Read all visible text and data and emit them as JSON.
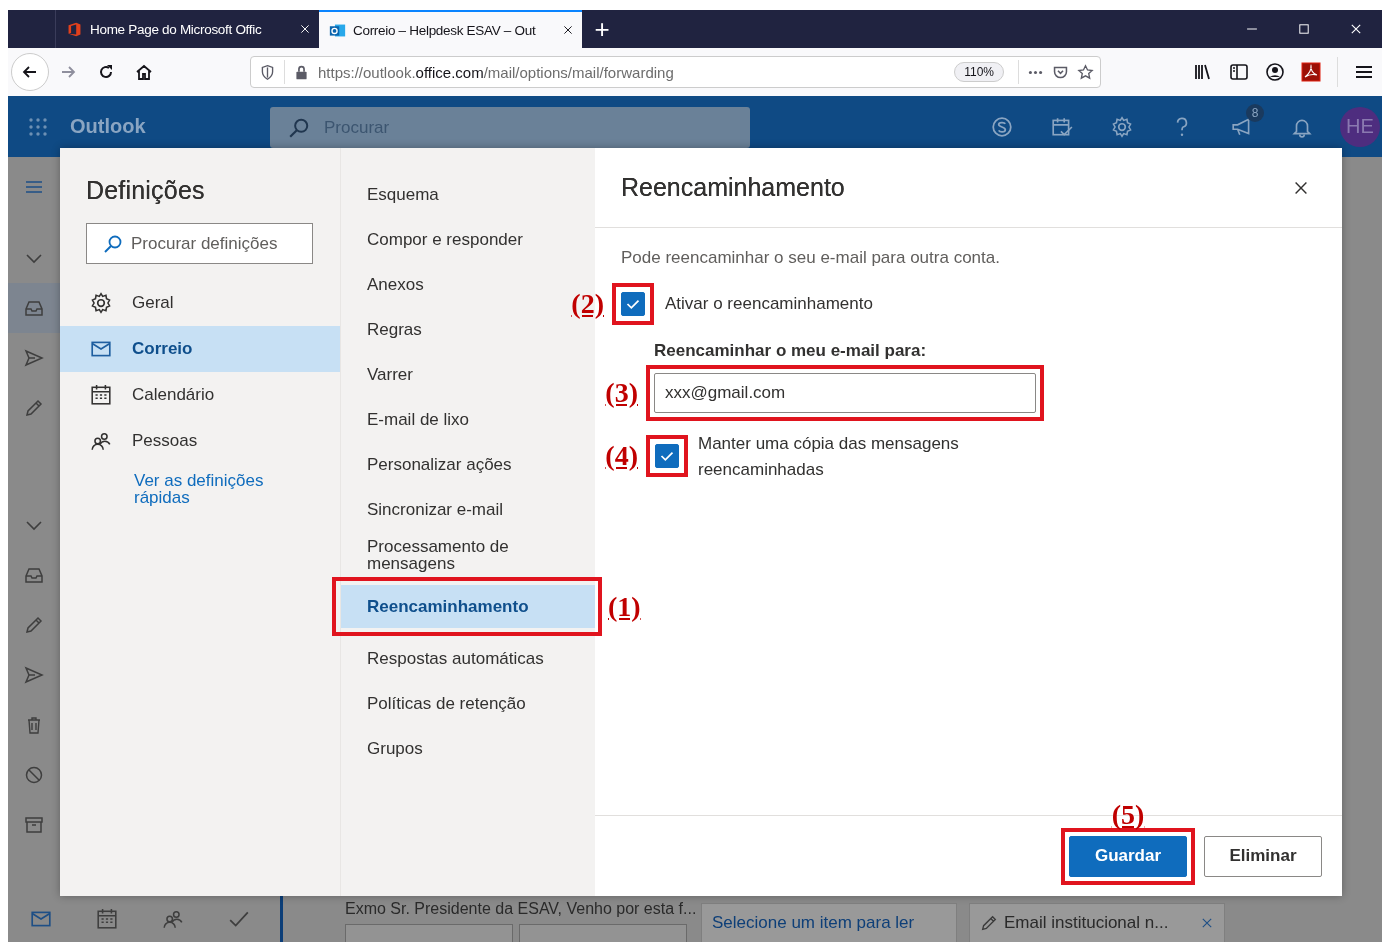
{
  "browser": {
    "tabs": [
      {
        "title": "Home Page do Microsoft Offic",
        "selected": false
      },
      {
        "title": "Correio – Helpdesk ESAV – Out",
        "selected": true
      }
    ],
    "new_tab": "+",
    "url": {
      "start": "https://outlook.",
      "domain": "office.com",
      "path": "/mail/options/mail/forwarding"
    },
    "zoom": "110%"
  },
  "outlook": {
    "app_name": "Outlook",
    "search_placeholder": "Procurar",
    "notification_count": "8",
    "avatar": "HE"
  },
  "background": {
    "message_preview": "Exmo Sr. Presidente da ESAV, Venho por esta f...",
    "reading_tabs": [
      {
        "label": "Selecione um item para ler",
        "kind": "link"
      },
      {
        "label": "Email institucional n...",
        "kind": "draft"
      }
    ]
  },
  "settings": {
    "title": "Definições",
    "search_placeholder": "Procurar definições",
    "categories": [
      {
        "label": "Geral",
        "selected": false
      },
      {
        "label": "Correio",
        "selected": true
      },
      {
        "label": "Calendário",
        "selected": false
      },
      {
        "label": "Pessoas",
        "selected": false
      }
    ],
    "quick_link": "Ver as definições rápidas",
    "sections": [
      {
        "label": "Esquema",
        "selected": false
      },
      {
        "label": "Compor e responder",
        "selected": false
      },
      {
        "label": "Anexos",
        "selected": false
      },
      {
        "label": "Regras",
        "selected": false
      },
      {
        "label": "Varrer",
        "selected": false
      },
      {
        "label": "E-mail de lixo",
        "selected": false
      },
      {
        "label": "Personalizar ações",
        "selected": false
      },
      {
        "label": "Sincronizar e-mail",
        "selected": false
      },
      {
        "label": "Processamento de mensagens",
        "selected": false
      },
      {
        "label": "Reencaminhamento",
        "selected": true,
        "annotation": "(1)"
      },
      {
        "label": "Respostas automáticas",
        "selected": false
      },
      {
        "label": "Políticas de retenção",
        "selected": false
      },
      {
        "label": "Grupos",
        "selected": false
      }
    ]
  },
  "forwarding": {
    "title": "Reencaminhamento",
    "description": "Pode reencaminhar o seu e-mail para outra conta.",
    "enable": {
      "label": "Ativar o reencaminhamento",
      "checked": true,
      "annotation": "(2)"
    },
    "address_label": "Reencaminhar o meu e-mail para:",
    "address": {
      "value": "xxx@gmail.com",
      "annotation": "(3)"
    },
    "keep_copy": {
      "label": "Manter uma cópia das mensagens reencaminhadas",
      "checked": true,
      "annotation": "(4)"
    },
    "buttons": [
      {
        "label": "Guardar",
        "kind": "primary",
        "annotation": "(5)"
      },
      {
        "label": "Eliminar",
        "kind": "secondary"
      }
    ]
  }
}
